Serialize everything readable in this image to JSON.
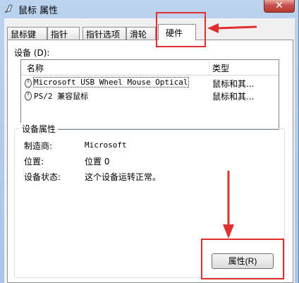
{
  "window": {
    "title": "鼠标 属性",
    "close_glyph": "✕"
  },
  "tabs": [
    {
      "label": "鼠标键"
    },
    {
      "label": "指针"
    },
    {
      "label": "指针选项"
    },
    {
      "label": "滑轮"
    },
    {
      "label": "硬件",
      "active": true
    }
  ],
  "devices": {
    "label": "设备 (D):",
    "columns": {
      "name": "名称",
      "type": "类型"
    },
    "rows": [
      {
        "name": "Microsoft USB Wheel Mouse Optical",
        "type": "鼠标和其...",
        "selected": true
      },
      {
        "name": "PS/2 兼容鼠标",
        "type": "鼠标和其..."
      }
    ]
  },
  "properties": {
    "group_title": "设备属性",
    "manufacturer_label": "制造商:",
    "manufacturer_value": "Microsoft",
    "location_label": "位置:",
    "location_value": "位置 0",
    "status_label": "设备状态:",
    "status_value": "这个设备运转正常。",
    "button_label": "属性(R)"
  },
  "colors": {
    "highlight": "#e0302e"
  }
}
